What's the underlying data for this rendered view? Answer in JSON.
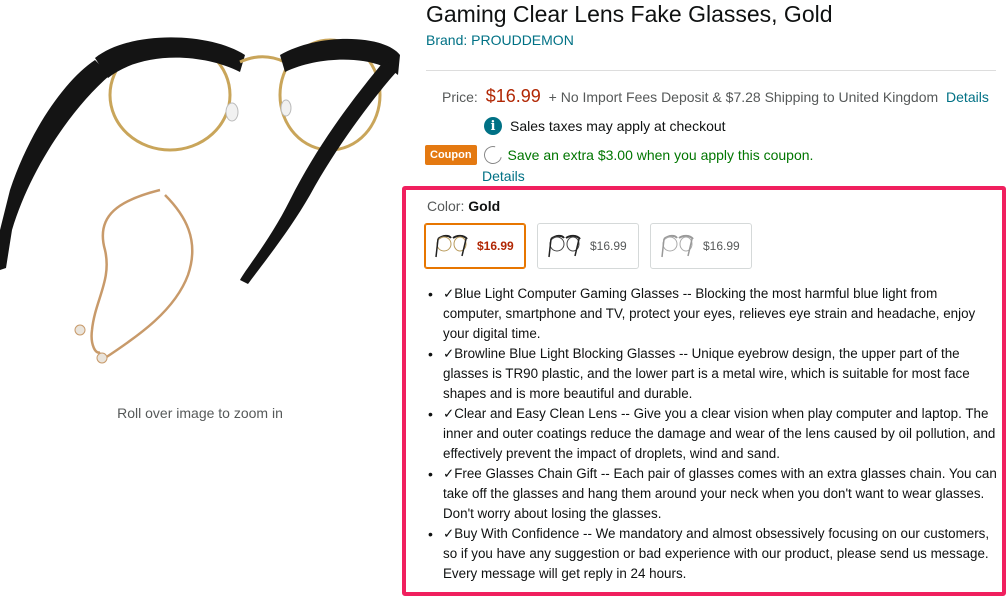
{
  "product": {
    "title": "Gaming Clear Lens Fake Glasses, Gold",
    "brand": "Brand: PROUDDEMON",
    "zoom_hint": "Roll over image to zoom in"
  },
  "price": {
    "label": "Price:",
    "value": "$16.99",
    "shipping": "+ No Import Fees Deposit & $7.28 Shipping to United Kingdom",
    "details_link": "Details"
  },
  "tax": {
    "icon": "info-icon",
    "text": "Sales taxes may apply at checkout"
  },
  "coupon": {
    "badge": "Coupon",
    "text": "Save an extra $3.00 when you apply this coupon.",
    "details_link": "Details"
  },
  "color": {
    "label": "Color:",
    "selected": "Gold",
    "swatches": [
      {
        "price": "$16.99",
        "selected": true
      },
      {
        "price": "$16.99",
        "selected": false
      },
      {
        "price": "$16.99",
        "selected": false
      }
    ]
  },
  "bullets": [
    "✓Blue Light Computer Gaming Glasses -- Blocking the most harmful blue light from computer, smartphone and TV, protect your eyes, relieves eye strain and headache, enjoy your digital time.",
    "✓Browline Blue Light Blocking Glasses -- Unique eyebrow design, the upper part of the glasses is TR90 plastic, and the lower part is a metal wire, which is suitable for most face shapes and is more beautiful and durable.",
    "✓Clear and Easy Clean Lens -- Give you a clear vision when play computer and laptop. The inner and outer coatings reduce the damage and wear of the lens caused by oil pollution, and effectively prevent the impact of droplets, wind and sand.",
    "✓Free Glasses Chain Gift -- Each pair of glasses comes with an extra glasses chain. You can take off the glasses and hang them around your neck when you don't want to wear glasses. Don't worry about losing the glasses.",
    "✓Buy With Confidence -- We mandatory and almost obsessively focusing on our customers, so if you have any suggestion or bad experience with our product, please send us message. Every message will get reply in 24 hours."
  ],
  "colors": {
    "link": "#007185",
    "price": "#b12704",
    "coupon_badge": "#e47911",
    "coupon_text": "#007600",
    "highlight": "#f0205e"
  }
}
